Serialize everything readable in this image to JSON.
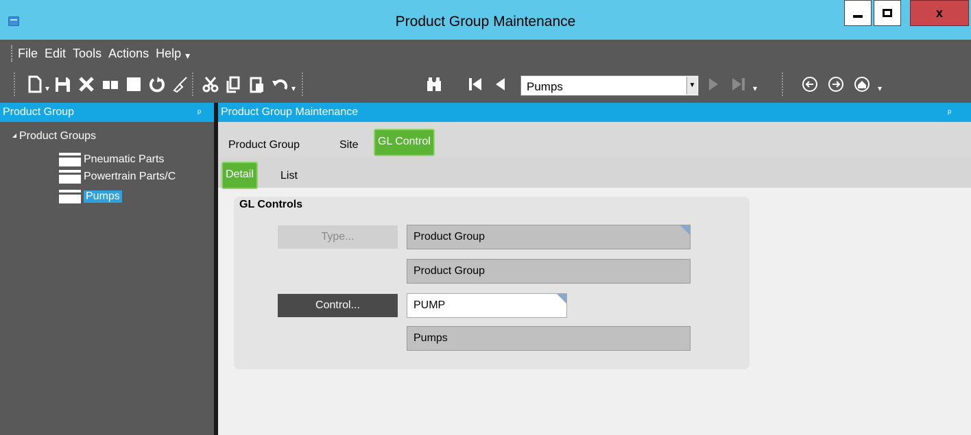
{
  "window": {
    "title": "Product Group Maintenance",
    "close_label": "x"
  },
  "menu": {
    "items": [
      "File",
      "Edit",
      "Tools",
      "Actions",
      "Help"
    ]
  },
  "toolbar": {
    "combo_value": "Pumps",
    "icons": [
      "new-icon",
      "save-icon",
      "delete-icon",
      "book-icon",
      "stop-icon",
      "refresh-icon",
      "clear-icon",
      "cut-icon",
      "copy-icon",
      "paste-icon",
      "undo-icon",
      "binoculars-icon",
      "first-record-icon",
      "previous-record-icon",
      "next-record-icon",
      "last-record-icon",
      "back-icon",
      "forward-icon",
      "home-icon"
    ]
  },
  "left_panel": {
    "header": "Product Group",
    "pin": "p",
    "tree": {
      "root": "Product Groups",
      "items": [
        "Pneumatic Parts",
        "Powertrain Parts/C",
        "Pumps"
      ],
      "selected": "Pumps"
    }
  },
  "main": {
    "header": "Product Group Maintenance",
    "tabs": [
      "Product Group",
      "Site",
      "GL Control"
    ],
    "active_tab": "GL Control",
    "subtabs": [
      "Detail",
      "List"
    ],
    "active_subtab": "Detail",
    "group_title": "GL Controls",
    "type_button": "Type...",
    "type_value": "Product Group",
    "type_description": "Product Group",
    "control_button": "Control...",
    "control_value": "PUMP",
    "control_description": "Pumps"
  },
  "colors": {
    "title_bar": "#5ec8ea",
    "panel_header": "#15a7e4",
    "active_tab": "#5bb434",
    "toolbar": "#595959"
  }
}
